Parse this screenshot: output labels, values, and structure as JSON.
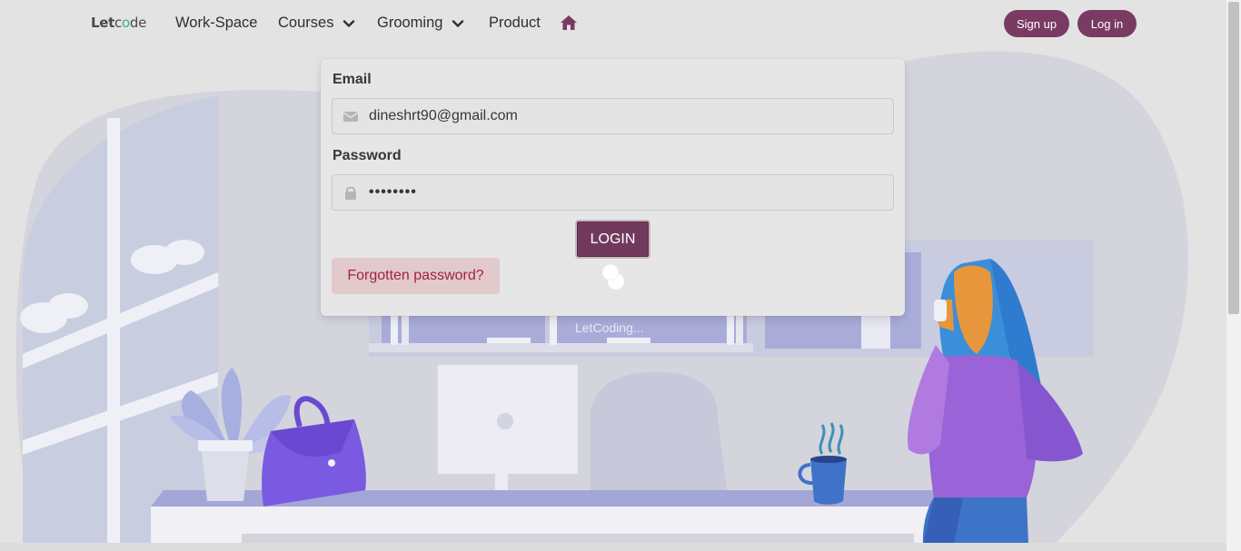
{
  "brand": {
    "part1": "Let",
    "part2": "c",
    "part3": "o",
    "part4": "de"
  },
  "nav": {
    "items": [
      {
        "label": "Work-Space"
      },
      {
        "label": "Courses"
      },
      {
        "label": "Grooming"
      },
      {
        "label": "Product"
      }
    ],
    "signup_label": "Sign up",
    "login_label": "Log in",
    "home_icon": "home-icon"
  },
  "form": {
    "email_label": "Email",
    "email_value": "dineshrt90@gmail.com",
    "password_label": "Password",
    "password_value": "Dinesh@1",
    "login_label": "LOGIN",
    "forgot_label": "Forgotten password?"
  },
  "loader": {
    "text": "LetCoding..."
  },
  "colors": {
    "brand_primary": "#7a3b63",
    "danger_light": "#e2c9cc",
    "danger_text": "#a1223f",
    "background": "#e3e3e3"
  }
}
